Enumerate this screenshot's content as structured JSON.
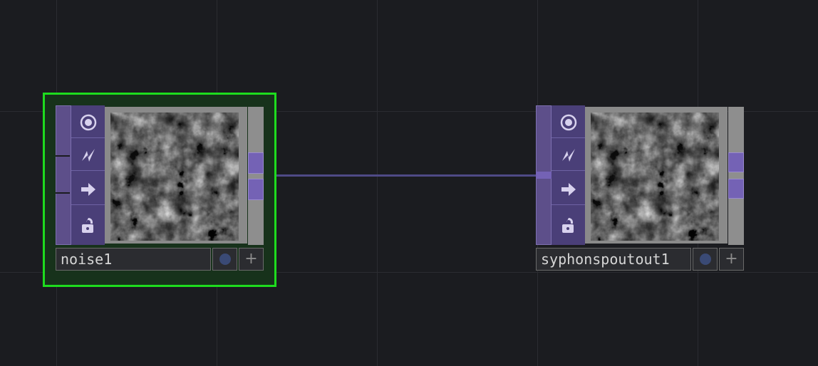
{
  "network": {
    "nodes": [
      {
        "name": "noise1",
        "selected": true,
        "type": "TOP"
      },
      {
        "name": "syphonspoutout1",
        "selected": false,
        "type": "TOP"
      }
    ],
    "flag_icons": [
      "viewer-active-icon",
      "cook-flag-icon",
      "export-flag-icon",
      "lock-icon"
    ],
    "button_glyphs": {
      "plus": "+"
    },
    "colors": {
      "selection": "#1edc1e",
      "node_purple": "#5d4f8a",
      "connector": "#7462b5",
      "wire": "#4f4a86",
      "background": "#1b1c20"
    }
  }
}
